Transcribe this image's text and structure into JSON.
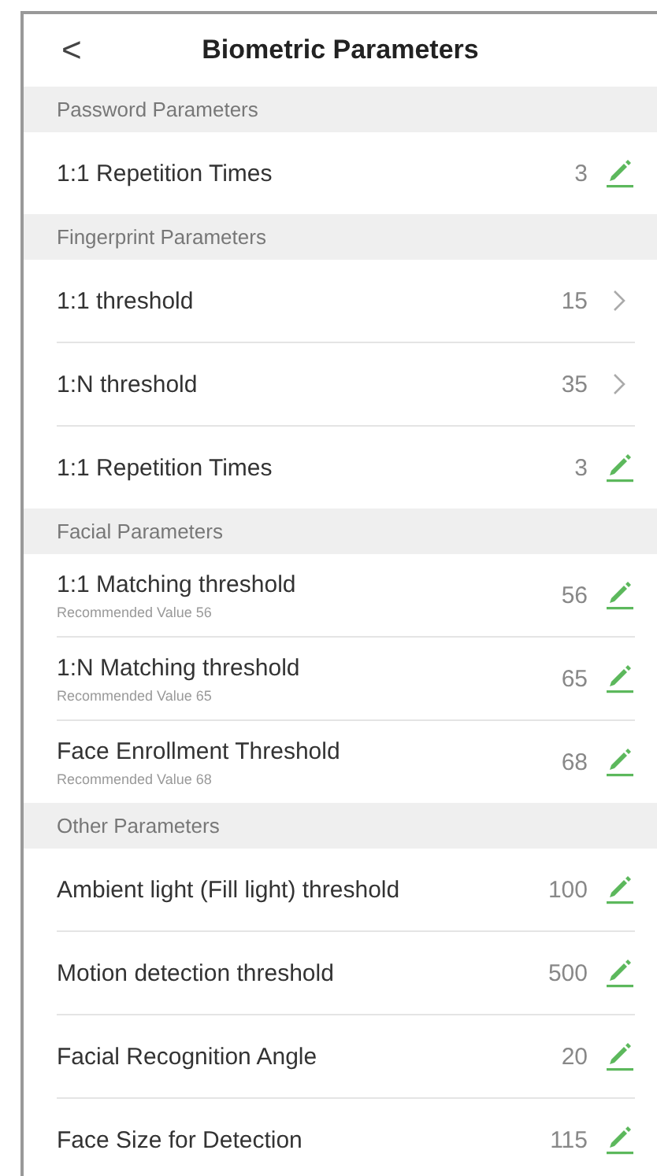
{
  "header": {
    "back": "<",
    "title": "Biometric Parameters"
  },
  "sections": [
    {
      "title": "Password Parameters",
      "rows": [
        {
          "label": "1:1 Repetition Times",
          "value": "3",
          "kind": "edit"
        }
      ]
    },
    {
      "title": "Fingerprint Parameters",
      "rows": [
        {
          "label": "1:1 threshold",
          "value": "15",
          "kind": "chevron"
        },
        {
          "label": "1:N threshold",
          "value": "35",
          "kind": "chevron"
        },
        {
          "label": "1:1 Repetition Times",
          "value": "3",
          "kind": "edit"
        }
      ]
    },
    {
      "title": "Facial Parameters",
      "rows": [
        {
          "label": "1:1 Matching threshold",
          "hint": "Recommended Value  56",
          "value": "56",
          "kind": "edit"
        },
        {
          "label": "1:N Matching threshold",
          "hint": "Recommended Value  65",
          "value": "65",
          "kind": "edit"
        },
        {
          "label": "Face Enrollment Threshold",
          "hint": "Recommended Value  68",
          "value": "68",
          "kind": "edit"
        }
      ]
    },
    {
      "title": "Other Parameters",
      "rows": [
        {
          "label": "Ambient light (Fill light) threshold",
          "value": "100",
          "kind": "edit"
        },
        {
          "label": "Motion detection threshold",
          "value": "500",
          "kind": "edit"
        },
        {
          "label": "Facial Recognition Angle",
          "value": "20",
          "kind": "edit"
        },
        {
          "label": "Face Size for Detection",
          "value": "115",
          "kind": "edit"
        }
      ]
    }
  ]
}
